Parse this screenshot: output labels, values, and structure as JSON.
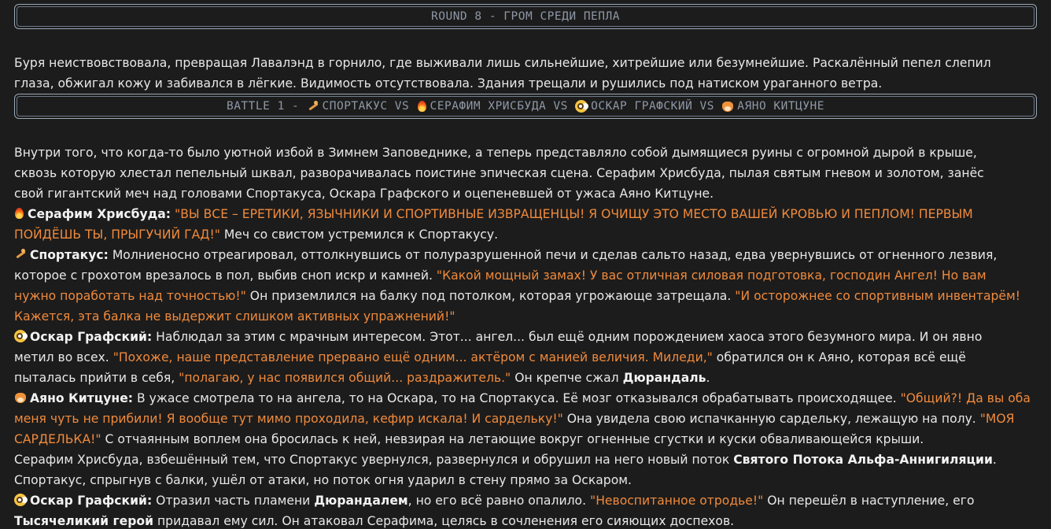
{
  "round_banner": "ROUND 8 - ГРОМ СРЕДИ ПЕПЛА",
  "intro": [
    "Буря неиствовствовала, превращая Лавалэнд в горнило, где выживали лишь сильнейшие, хитрейшие или безумнейшие. Раскалённый пепел слепил",
    "глаза, обжигал кожу и забивался в лёгкие. Видимость отсутствовала. Здания трещали и рушились под натиском ураганного ветра."
  ],
  "battle_banner": {
    "prefix": "BATTLE 1 - ",
    "fighters": [
      "СПОРТАКУС",
      "СЕРАФИМ ХРИСБУДА",
      "ОСКАР ГРАФСКИЙ",
      "АЯНО КИТЦУНЕ"
    ],
    "separator": " VS "
  },
  "icons": {
    "sportakus": "runner-icon",
    "serafim": "flame-icon",
    "oskar": "monocle-face-icon",
    "ayano": "fox-icon"
  },
  "colors": {
    "background": "#1c1c1c",
    "text": "#e8e8e8",
    "quote": "#f08a3c",
    "banner_border": "#9aa8b8",
    "banner_text": "#8f98a6"
  },
  "scene": {
    "l1": "Внутри того, что когда-то было уютной избой в Зимнем Заповеднике, а теперь представляло собой дымящиеся руины с огромной дырой в крыше,",
    "l2": "сквозь которую хлестал пепельный шквал, разворачивалась поистине эпическая сцена. Серафим Хрисбуда, пылая святым гневом и золотом, занёс",
    "l3": "свой гигантский меч над головами Спортакуса, Оскара Графского и оцепеневшей от ужаса Аяно Китцуне.",
    "l4_name": "Серафим Хрисбуда:",
    "l4_quote": "\"ВЫ ВСЕ – ЕРЕТИКИ, ЯЗЫЧНИКИ И СПОРТИВНЫЕ ИЗВРАЩЕНЦЫ! Я ОЧИЩУ ЭТО МЕСТО ВАШЕЙ КРОВЬЮ И ПЕПЛОМ! ПЕРВЫМ",
    "l5_quote": "ПОЙДЁШЬ ТЫ, ПРЫГУЧИЙ ГАД!\"",
    "l5_text": " Меч со свистом устремился к Спортакусу.",
    "l6_name": "Спортакус:",
    "l6_text": " Молниеносно отреагировал, оттолкнувшись от полуразрушенной печи и сделав сальто назад, едва увернувшись от огненного лезвия,",
    "l7_text": "которое с грохотом врезалось в пол, выбив сноп искр и камней. ",
    "l7_quote": "\"Какой мощный замах! У вас отличная силовая подготовка, господин Ангел! Но вам",
    "l8_quote": "нужно поработать над точностью!\"",
    "l8_text": " Он приземлился на балку под потолком, которая угрожающе затрещала. ",
    "l8_quote2": "\"И осторожнее со спортивным инвентарём!",
    "l9_quote": "Кажется, эта балка не выдержит слишком активных упражнений!\"",
    "l10_name": "Оскар Графский:",
    "l10_text": " Наблюдал за этим с мрачным интересом. Этот... ангел... был ещё одним порождением хаоса этого безумного мира. И он явно",
    "l11_text": "метил во всех. ",
    "l11_quote": "\"Похоже, наше представление прервано ещё одним... актёром с манией величия. Миледи,\"",
    "l11_text2": " обратился он к Аяно, которая всё ещё",
    "l12_text": "пыталась прийти в себя, ",
    "l12_quote": "\"полагаю, у нас появился общий... раздражитель.\"",
    "l12_text2": " Он крепче сжал ",
    "l12_bold": "Дюрандаль",
    "l12_end": ".",
    "l13_name": "Аяно Китцуне:",
    "l13_text": " В ужасе смотрела то на ангела, то на Оскара, то на Спортакуса. Её мозг отказывался обрабатывать происходящее. ",
    "l13_quote": "\"Общий?! Да вы оба",
    "l14_quote": "меня чуть не прибили! Я вообще тут мимо проходила, кефир искала! И сардельку!\"",
    "l14_text": " Она увидела свою испачканную сардельку, лежащую на полу. ",
    "l14_quote2": "\"МОЯ",
    "l15_quote": "САРДЕЛЬКА!\"",
    "l15_text": " С отчаянным воплем она бросилась к ней, невзирая на летающие вокруг огненные сгустки и куски обваливающейся крыши.",
    "l16_text": "Серафим Хрисбуда, взбешённый тем, что Спортакус увернулся, развернулся и обрушил на него новый поток ",
    "l16_bold": "Святого Потока Альфа-Аннигиляции",
    "l16_end": ".",
    "l17_text": "Спортакус, спрыгнув с балки, ушёл от атаки, но поток огня ударил в стену прямо за Оскаром.",
    "l18_name": "Оскар Графский:",
    "l18_text": " Отразил часть пламени ",
    "l18_bold": "Дюрандалем",
    "l18_text2": ", но его всё равно опалило. ",
    "l18_quote": "\"Невоспитанное отродье!\"",
    "l18_text3": " Он перешёл в наступление, его",
    "l19_bold": "Тысячеликий герой",
    "l19_text": " придавал ему сил. Он атаковал Серафима, целясь в сочленения его сияющих доспехов."
  }
}
